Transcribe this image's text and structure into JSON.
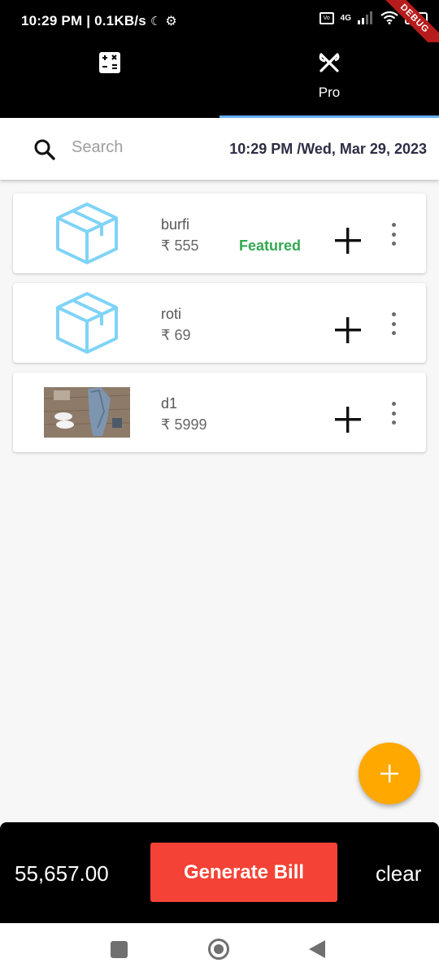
{
  "status_bar": {
    "time_speed": "10:29 PM | 0.1KB/s",
    "network": "4G",
    "battery": "27",
    "debug_banner": "DEBUG"
  },
  "tabs": [
    {
      "icon": "calculator-icon",
      "label": ""
    },
    {
      "icon": "fork-knife-icon",
      "label": "Pro"
    }
  ],
  "search": {
    "placeholder": "Search"
  },
  "datetime": "10:29 PM /Wed, Mar 29, 2023",
  "products": [
    {
      "name": "burfi",
      "price": "₹ 555",
      "badge": "Featured",
      "image": "box-icon"
    },
    {
      "name": "roti",
      "price": "₹ 69",
      "badge": "",
      "image": "box-icon"
    },
    {
      "name": "d1",
      "price": "₹ 5999",
      "badge": "",
      "image": "product-photo"
    }
  ],
  "bottom": {
    "total": "55,657.00",
    "generate_label": "Generate Bill",
    "clear_label": "clear"
  },
  "colors": {
    "accent_tab_indicator": "#64b5f6",
    "featured": "#34a853",
    "fab": "#ffa800",
    "generate_button": "#f44336",
    "box_icon": "#7fd3f7"
  }
}
